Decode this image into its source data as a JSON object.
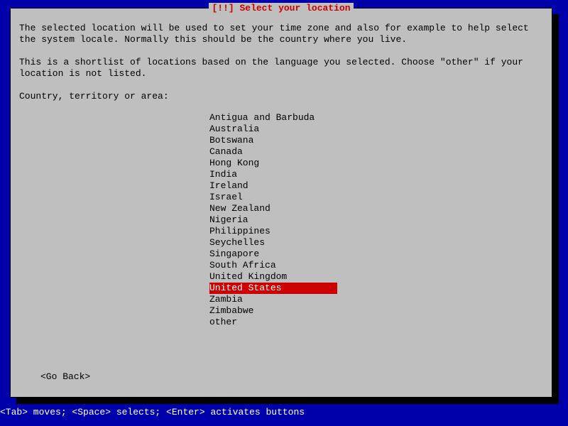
{
  "colors": {
    "background": "#0000aa",
    "panel": "#bfbfbf",
    "accent": "#cc0000",
    "shadow": "#000000",
    "footer_text": "#ffffff"
  },
  "dialog": {
    "title": "[!!] Select your location",
    "paragraph1": "The selected location will be used to set your time zone and also for example to help select the system locale. Normally this should be the country where you live.",
    "paragraph2": "This is a shortlist of locations based on the language you selected. Choose \"other\" if your location is not listed.",
    "prompt": "Country, territory or area:",
    "go_back": "<Go Back>"
  },
  "locations": [
    {
      "label": "Antigua and Barbuda",
      "selected": false
    },
    {
      "label": "Australia",
      "selected": false
    },
    {
      "label": "Botswana",
      "selected": false
    },
    {
      "label": "Canada",
      "selected": false
    },
    {
      "label": "Hong Kong",
      "selected": false
    },
    {
      "label": "India",
      "selected": false
    },
    {
      "label": "Ireland",
      "selected": false
    },
    {
      "label": "Israel",
      "selected": false
    },
    {
      "label": "New Zealand",
      "selected": false
    },
    {
      "label": "Nigeria",
      "selected": false
    },
    {
      "label": "Philippines",
      "selected": false
    },
    {
      "label": "Seychelles",
      "selected": false
    },
    {
      "label": "Singapore",
      "selected": false
    },
    {
      "label": "South Africa",
      "selected": false
    },
    {
      "label": "United Kingdom",
      "selected": false
    },
    {
      "label": "United States",
      "selected": true
    },
    {
      "label": "Zambia",
      "selected": false
    },
    {
      "label": "Zimbabwe",
      "selected": false
    },
    {
      "label": "other",
      "selected": false
    }
  ],
  "footer": {
    "hint": "<Tab> moves; <Space> selects; <Enter> activates buttons"
  }
}
